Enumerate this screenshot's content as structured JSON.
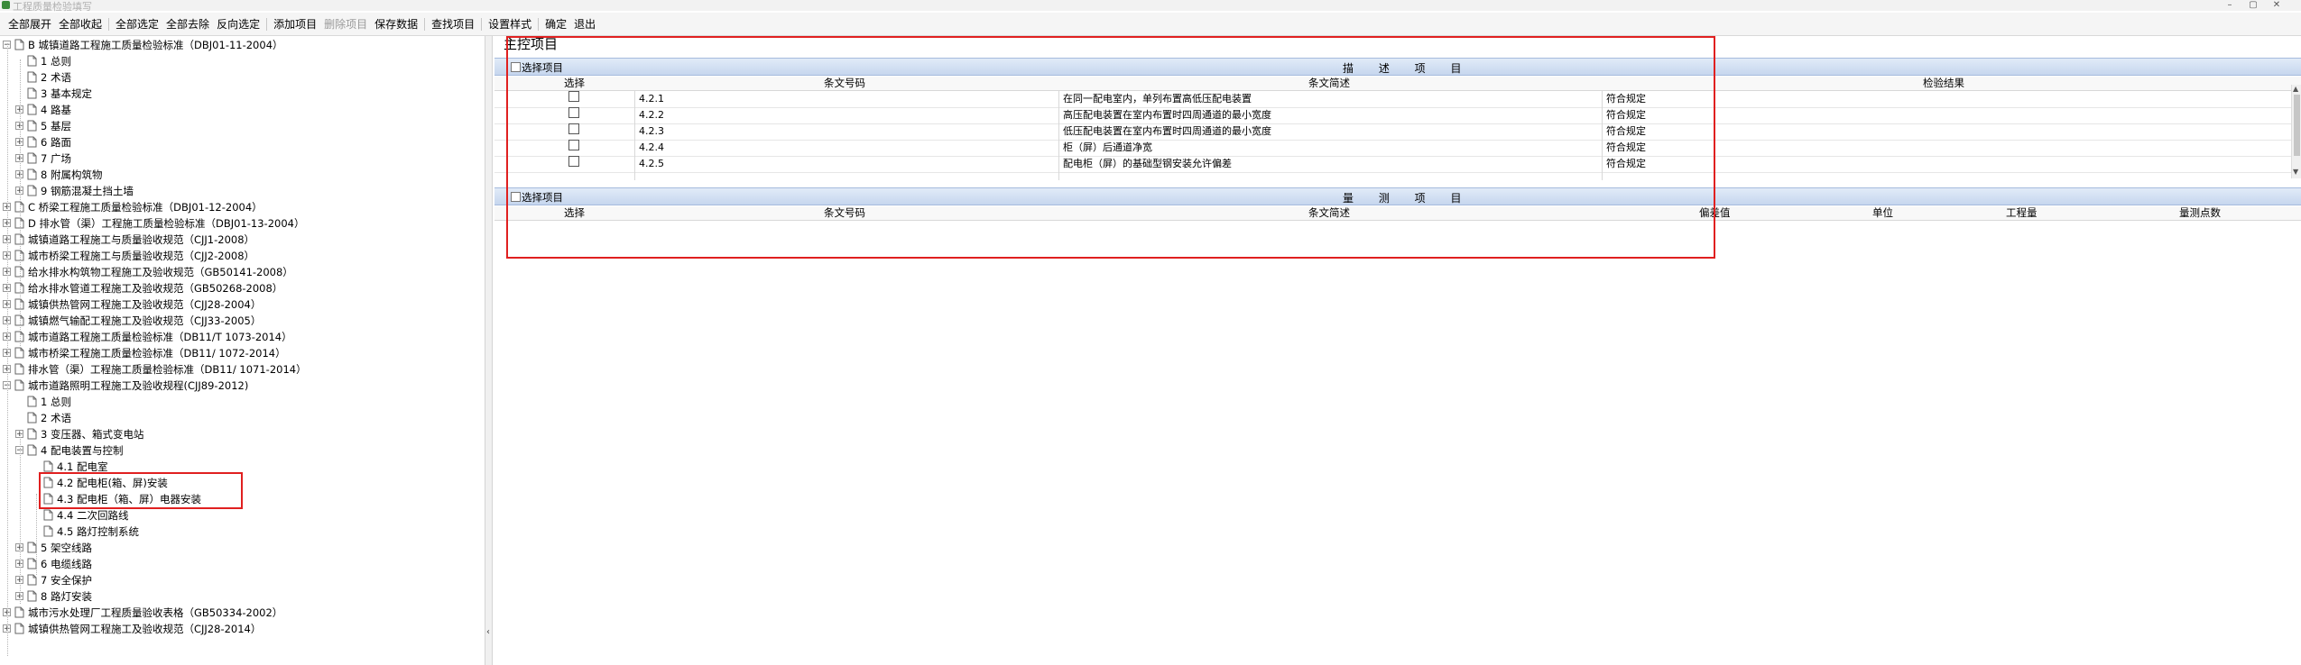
{
  "window": {
    "title": "工程质量检验填写"
  },
  "toolbar": {
    "buttons": [
      "全部展开",
      "全部收起",
      "全部选定",
      "全部去除",
      "反向选定",
      "添加项目",
      "删除项目",
      "保存数据",
      "查找项目",
      "设置样式",
      "确定",
      "退出"
    ]
  },
  "tree": {
    "nodes": [
      "B 城镇道路工程施工质量检验标准（DBJ01-11-2004）",
      "1 总则",
      "2 术语",
      "3 基本规定",
      "4 路基",
      "5 基层",
      "6 路面",
      "7 广场",
      "8 附属构筑物",
      "9 钢筋混凝土挡土墙",
      "C 桥梁工程施工质量检验标准（DBJ01-12-2004）",
      "D 排水管（渠）工程施工质量检验标准（DBJ01-13-2004）",
      "城镇道路工程施工与质量验收规范（CJJ1-2008）",
      "城市桥梁工程施工与质量验收规范（CJJ2-2008）",
      "给水排水构筑物工程施工及验收规范（GB50141-2008）",
      "给水排水管道工程施工及验收规范（GB50268-2008）",
      "城镇供热管网工程施工及验收规范（CJJ28-2004）",
      "城镇燃气输配工程施工及验收规范（CJJ33-2005）",
      "城市道路工程施工质量检验标准（DB11/T 1073-2014）",
      "城市桥梁工程施工质量检验标准（DB11/ 1072-2014）",
      "排水管（渠）工程施工质量检验标准（DB11/ 1071-2014）",
      "城市道路照明工程施工及验收规程(CJJ89-2012)",
      "1 总则",
      "2 术语",
      "3 变压器、箱式变电站",
      "4 配电装置与控制",
      "4.1 配电室",
      "4.2 配电柜(箱、屏)安装",
      "4.3 配电柜（箱、屏）电器安装",
      "4.4 二次回路线",
      "4.5 路灯控制系统",
      "5 架空线路",
      "6 电缆线路",
      "7 安全保护",
      "8 路灯安装",
      "城市污水处理厂工程质量验收表格（GB50334-2002）",
      "城镇供热管网工程施工及验收规范（CJJ28-2014）"
    ]
  },
  "main": {
    "section_title": "主控项目",
    "panel1": {
      "select_label": "选择项目",
      "heading": "描 述 项 目",
      "columns": [
        "选择",
        "条文号码",
        "条文简述",
        "检验结果"
      ],
      "rows": [
        {
          "code": "4.2.1",
          "desc": "在同一配电室内，单列布置高低压配电装置",
          "result": "符合规定"
        },
        {
          "code": "4.2.2",
          "desc": "高压配电装置在室内布置时四周通道的最小宽度",
          "result": "符合规定"
        },
        {
          "code": "4.2.3",
          "desc": "低压配电装置在室内布置时四周通道的最小宽度",
          "result": "符合规定"
        },
        {
          "code": "4.2.4",
          "desc": "柜（屏）后通道净宽",
          "result": "符合规定"
        },
        {
          "code": "4.2.5",
          "desc": "配电柜（屏）的基础型钢安装允许偏差",
          "result": "符合规定"
        }
      ]
    },
    "panel2": {
      "select_label": "选择项目",
      "heading": "量 测 项 目",
      "columns": [
        "选择",
        "条文号码",
        "条文简述",
        "偏差值",
        "单位",
        "工程量",
        "量测点数"
      ]
    }
  },
  "colors": {
    "highlight": "#e02020",
    "bar": "#c6d6ee"
  }
}
